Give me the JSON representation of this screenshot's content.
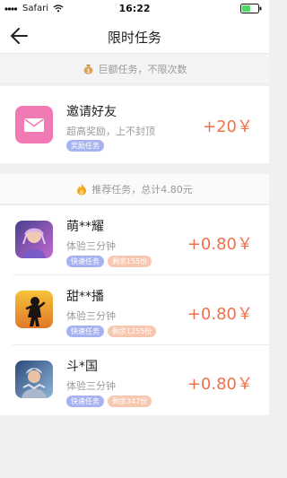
{
  "status_bar": {
    "carrier": "Safari",
    "time": "16:22"
  },
  "nav": {
    "title": "限时任务"
  },
  "section_big": {
    "text": "巨额任务，不限次数",
    "icon": "money-bag-icon"
  },
  "invite": {
    "title": "邀请好友",
    "subtitle": "超高奖励，上不封顶",
    "tag": "奖励任务",
    "reward": "+20￥",
    "icon": "envelope-icon",
    "icon_color": "#f27ab4"
  },
  "section_recommend": {
    "text": "推荐任务，总计4.80元",
    "icon": "flame-icon"
  },
  "tasks": [
    {
      "name": "萌**耀",
      "desc": "体验三分钟",
      "tag": "快速任务",
      "remaining": "剩余155份",
      "reward": "+0.80￥",
      "icon": "game-icon-1"
    },
    {
      "name": "甜**播",
      "desc": "体验三分钟",
      "tag": "快速任务",
      "remaining": "剩余1255份",
      "reward": "+0.80￥",
      "icon": "game-icon-2"
    },
    {
      "name": "斗*国",
      "desc": "体验三分钟",
      "tag": "快速任务",
      "remaining": "剩余347份",
      "reward": "+0.80￥",
      "icon": "game-icon-3"
    }
  ],
  "colors": {
    "accent_reward": "#f0714c",
    "tag_blue": "#a7b3f0",
    "tag_orange": "#f7c7b0"
  }
}
